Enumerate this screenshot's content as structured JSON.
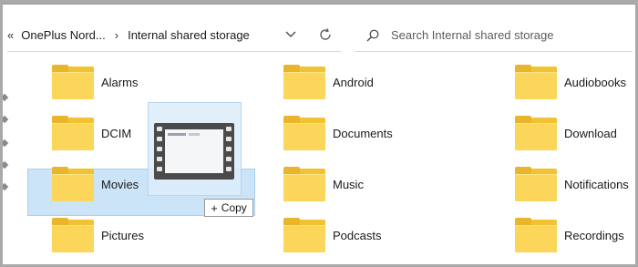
{
  "address_bar": {
    "breadcrumbs": [
      "OnePlus Nord...",
      "Internal shared storage"
    ]
  },
  "search": {
    "placeholder": "Search Internal shared storage"
  },
  "folders": [
    {
      "name": "Alarms"
    },
    {
      "name": "Android"
    },
    {
      "name": "Audiobooks"
    },
    {
      "name": "DCIM"
    },
    {
      "name": "Documents"
    },
    {
      "name": "Download"
    },
    {
      "name": "Movies"
    },
    {
      "name": "Music"
    },
    {
      "name": "Notifications"
    },
    {
      "name": "Pictures"
    },
    {
      "name": "Podcasts"
    },
    {
      "name": "Recordings"
    }
  ],
  "drag": {
    "copy_label": "Copy",
    "copy_symbol": "+"
  },
  "colors": {
    "folder": "#fbd65a",
    "selection": "#cce4f7"
  }
}
